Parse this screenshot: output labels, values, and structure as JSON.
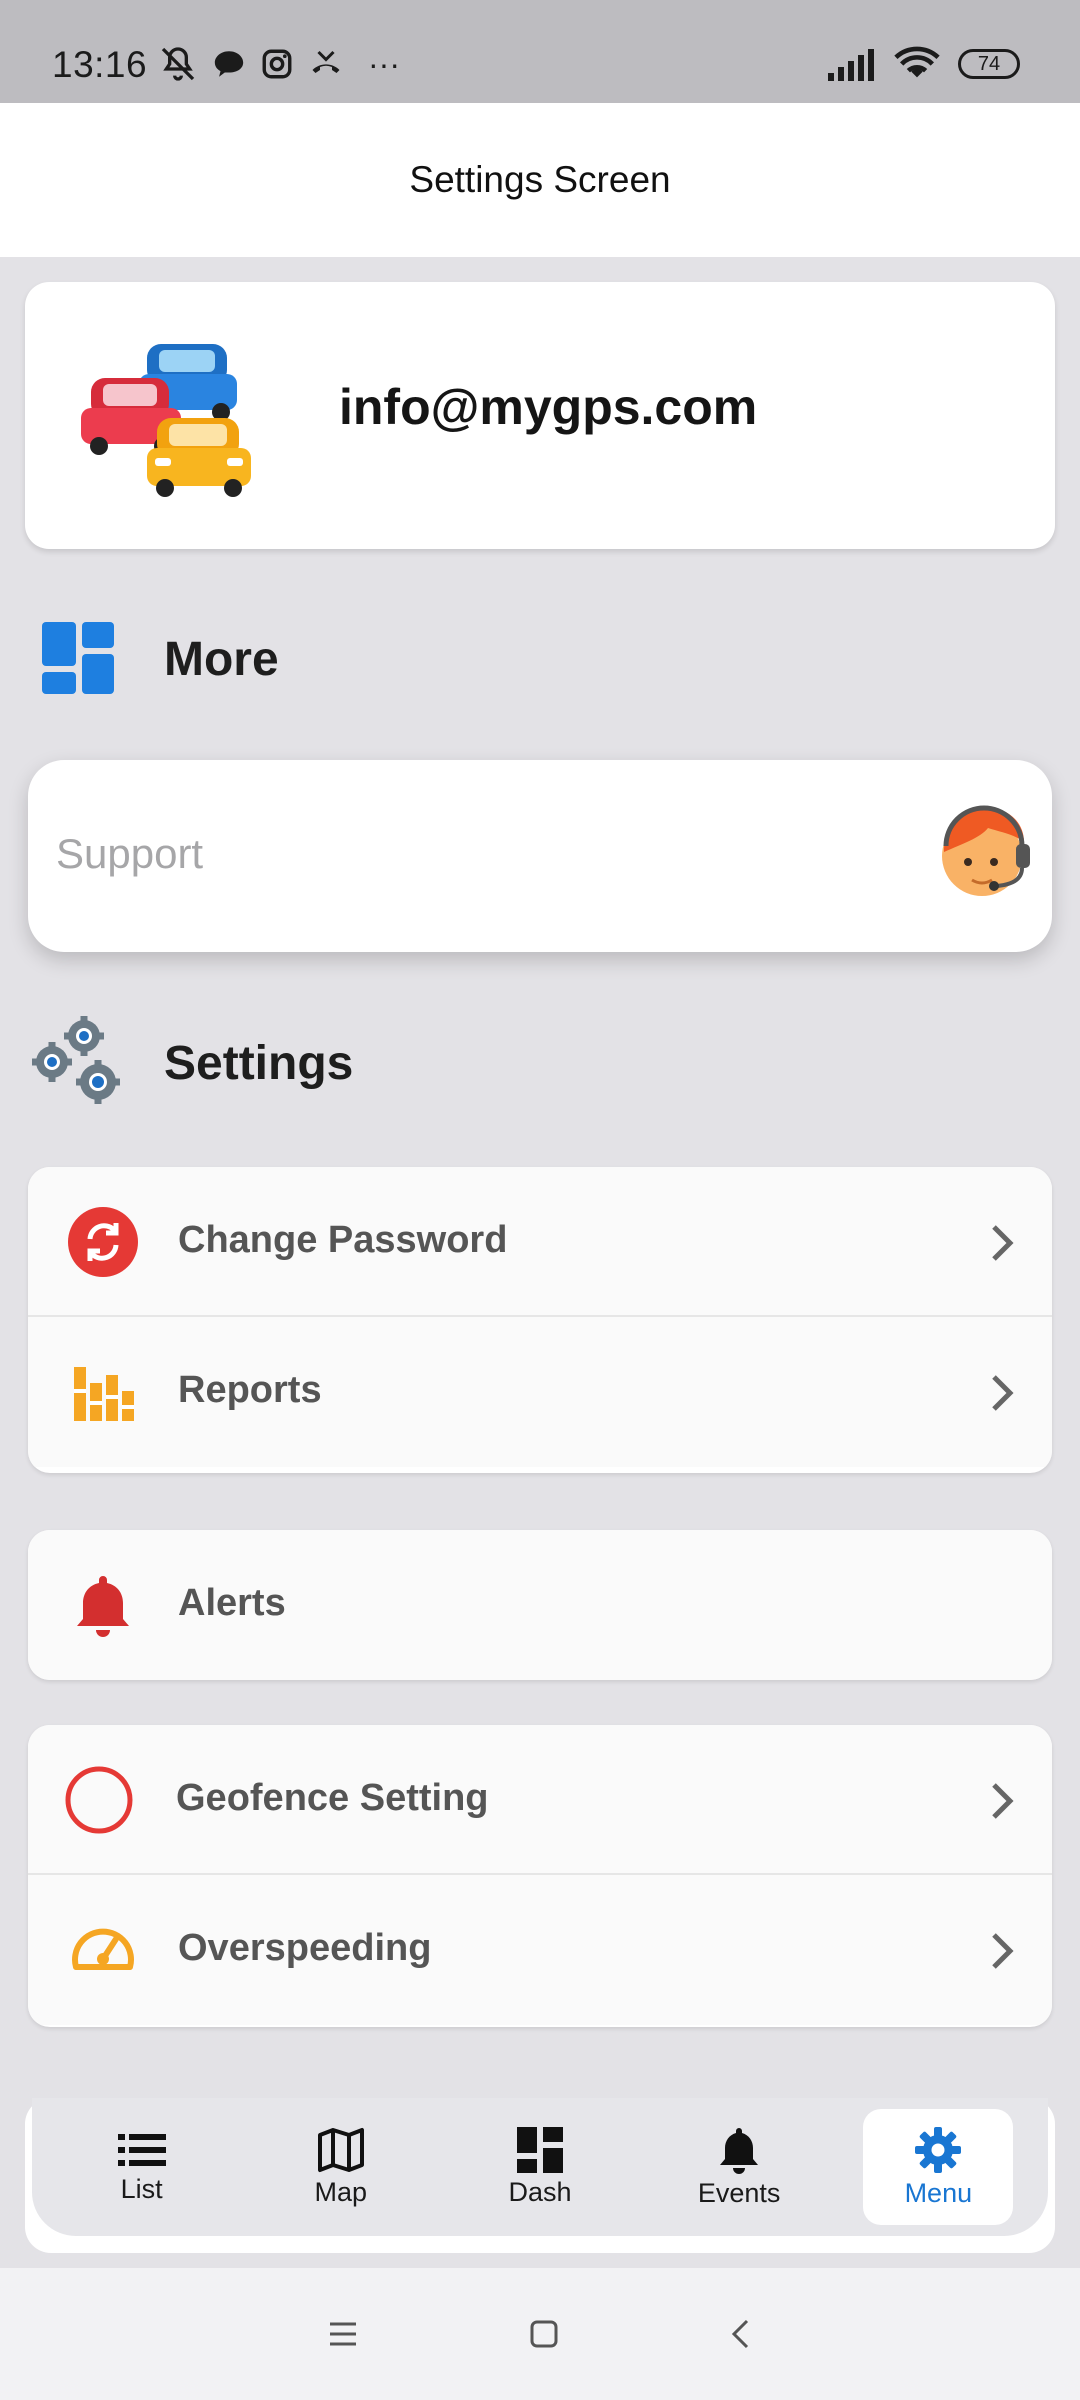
{
  "status_bar": {
    "time": "13:16",
    "battery": "74",
    "more": "···"
  },
  "app_bar": {
    "title": "Settings Screen"
  },
  "profile": {
    "email": "info@mygps.com"
  },
  "sections": {
    "more_title": "More",
    "settings_title": "Settings"
  },
  "support": {
    "label": "Support"
  },
  "settings_items": [
    {
      "label": "Change Password",
      "icon": "refresh-icon",
      "color": "#e53935"
    },
    {
      "label": "Reports",
      "icon": "bar-chart-icon",
      "color": "#f5a623"
    },
    {
      "label": "Alerts",
      "icon": "bell-icon",
      "color": "#d32f2f"
    },
    {
      "label": "Geofence Setting",
      "icon": "circle-icon",
      "color": "#e53935"
    },
    {
      "label": "Overspeeding",
      "icon": "speedometer-icon",
      "color": "#f5a623"
    }
  ],
  "bottom_nav": [
    {
      "label": "List",
      "icon": "list-icon"
    },
    {
      "label": "Map",
      "icon": "map-icon"
    },
    {
      "label": "Dash",
      "icon": "dashboard-icon"
    },
    {
      "label": "Events",
      "icon": "bell-icon"
    },
    {
      "label": "Menu",
      "icon": "gear-icon",
      "active": true
    }
  ],
  "colors": {
    "accent": "#1976d2",
    "background": "#e3e2e6"
  }
}
